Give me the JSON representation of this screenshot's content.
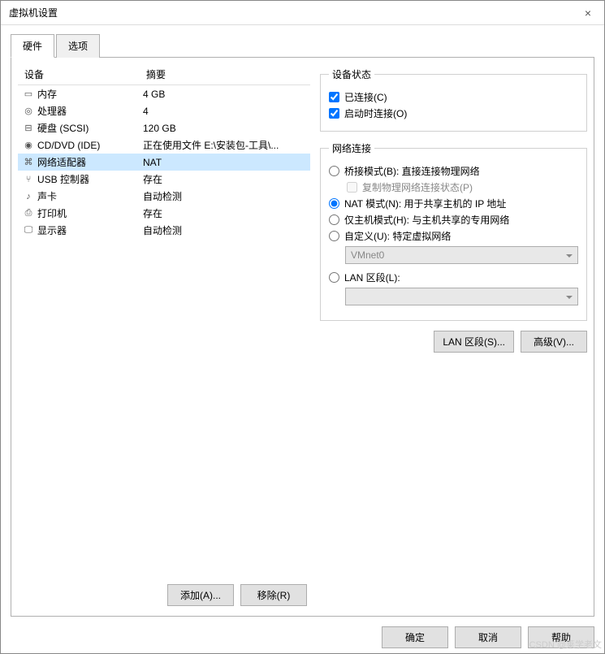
{
  "window": {
    "title": "虚拟机设置",
    "close": "×"
  },
  "tabs": {
    "hardware": "硬件",
    "options": "选项"
  },
  "headers": {
    "device": "设备",
    "summary": "摘要"
  },
  "devices": [
    {
      "icon": "memory-icon",
      "glyph": "▭",
      "name": "内存",
      "summary": "4 GB",
      "sel": false
    },
    {
      "icon": "cpu-icon",
      "glyph": "◎",
      "name": "处理器",
      "summary": "4",
      "sel": false
    },
    {
      "icon": "disk-icon",
      "glyph": "⊟",
      "name": "硬盘 (SCSI)",
      "summary": "120 GB",
      "sel": false
    },
    {
      "icon": "cd-icon",
      "glyph": "◉",
      "name": "CD/DVD (IDE)",
      "summary": "正在使用文件 E:\\安装包-工具\\...",
      "sel": false
    },
    {
      "icon": "network-icon",
      "glyph": "⌘",
      "name": "网络适配器",
      "summary": "NAT",
      "sel": true
    },
    {
      "icon": "usb-icon",
      "glyph": "⑂",
      "name": "USB 控制器",
      "summary": "存在",
      "sel": false
    },
    {
      "icon": "sound-icon",
      "glyph": "♪",
      "name": "声卡",
      "summary": "自动检测",
      "sel": false
    },
    {
      "icon": "printer-icon",
      "glyph": "⎙",
      "name": "打印机",
      "summary": "存在",
      "sel": false
    },
    {
      "icon": "display-icon",
      "glyph": "🖵",
      "name": "显示器",
      "summary": "自动检测",
      "sel": false
    }
  ],
  "leftButtons": {
    "add": "添加(A)...",
    "remove": "移除(R)"
  },
  "status": {
    "legend": "设备状态",
    "connected": "已连接(C)",
    "connectOnStart": "启动时连接(O)"
  },
  "network": {
    "legend": "网络连接",
    "bridged": "桥接模式(B): 直接连接物理网络",
    "replicate": "复制物理网络连接状态(P)",
    "nat": "NAT 模式(N): 用于共享主机的 IP 地址",
    "hostonly": "仅主机模式(H): 与主机共享的专用网络",
    "custom": "自定义(U): 特定虚拟网络",
    "vmnet": "VMnet0",
    "lanseg": "LAN 区段(L):",
    "lansegval": ""
  },
  "rightButtons": {
    "lanseg": "LAN 区段(S)...",
    "advanced": "高级(V)..."
  },
  "footer": {
    "ok": "确定",
    "cancel": "取消",
    "help": "帮助"
  },
  "watermark": "CSDN @莱学老文"
}
